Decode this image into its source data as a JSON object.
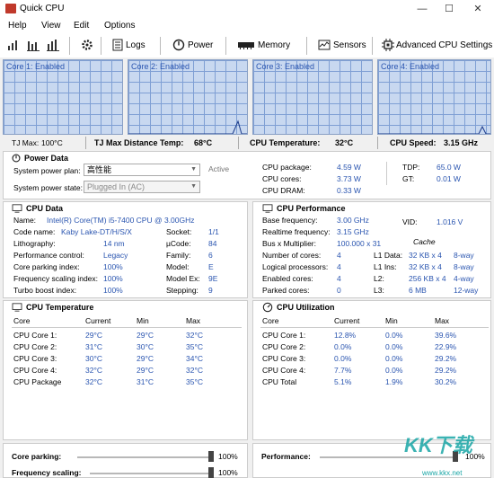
{
  "window": {
    "title": "Quick CPU",
    "minimize": "—",
    "maximize": "☐",
    "close": "✕"
  },
  "menu": {
    "help": "Help",
    "view": "View",
    "edit": "Edit",
    "options": "Options"
  },
  "toolbar": {
    "logs": "Logs",
    "power": "Power",
    "memory": "Memory",
    "sensors": "Sensors",
    "advanced": "Advanced CPU Settings"
  },
  "graphs": [
    {
      "label": "Core 1: Enabled"
    },
    {
      "label": "Core 2: Enabled"
    },
    {
      "label": "Core 3: Enabled"
    },
    {
      "label": "Core 4: Enabled"
    }
  ],
  "status": {
    "tj_max_label": "TJ Max:",
    "tj_max_value": "100°C",
    "tj_dist_label": "TJ Max Distance Temp:",
    "tj_dist_value": "68°C",
    "cpu_temp_label": "CPU Temperature:",
    "cpu_temp_value": "32°C",
    "cpu_speed_label": "CPU Speed:",
    "cpu_speed_value": "3.15 GHz"
  },
  "power_data": {
    "title": "Power Data",
    "plan_label": "System power plan:",
    "plan_value": "高性能",
    "active": "Active",
    "state_label": "System power state:",
    "state_value": "Plugged In (AC)",
    "package_label": "CPU package:",
    "package_value": "4.59 W",
    "cores_label": "CPU cores:",
    "cores_value": "3.73 W",
    "dram_label": "CPU DRAM:",
    "dram_value": "0.33 W",
    "tdp_label": "TDP:",
    "tdp_value": "65.0 W",
    "gt_label": "GT:",
    "gt_value": "0.01 W"
  },
  "cpu_data": {
    "title": "CPU Data",
    "rows": [
      {
        "label": "Name:",
        "value": "Intel(R) Core(TM) i5-7400 CPU @ 3.00GHz"
      },
      {
        "label": "Code name:",
        "value": "Kaby Lake-DT/H/S/X"
      },
      {
        "label": "Lithography:",
        "value": "14 nm"
      },
      {
        "label": "Performance control:",
        "value": "Legacy"
      },
      {
        "label": "Core parking index:",
        "value": "100%"
      },
      {
        "label": "Frequency scaling index:",
        "value": "100%"
      },
      {
        "label": "Turbo boost index:",
        "value": "100%"
      }
    ],
    "right": [
      {
        "label": "Socket:",
        "value": "1/1"
      },
      {
        "label": "µCode:",
        "value": "84"
      },
      {
        "label": "Family:",
        "value": "6"
      },
      {
        "label": "Model:",
        "value": "E"
      },
      {
        "label": "Model Ex:",
        "value": "9E"
      },
      {
        "label": "Stepping:",
        "value": "9"
      }
    ]
  },
  "cpu_perf": {
    "title": "CPU Performance",
    "base_label": "Base frequency:",
    "base_value": "3.00 GHz",
    "rt_label": "Realtime frequency:",
    "rt_value": "3.15 GHz",
    "bus_label": "Bus x Multiplier:",
    "bus_value": "100.000 x 31",
    "vid_label": "VID:",
    "vid_value": "1.016 V",
    "cache_title": "Cache",
    "rows": [
      {
        "label": "Number of cores:",
        "value": "4",
        "cl": "L1 Data:",
        "cv": "32 KB x 4",
        "cw": "8-way"
      },
      {
        "label": "Logical processors:",
        "value": "4",
        "cl": "L1 Ins:",
        "cv": "32 KB x 4",
        "cw": "8-way"
      },
      {
        "label": "Enabled cores:",
        "value": "4",
        "cl": "L2:",
        "cv": "256 KB x 4",
        "cw": "4-way"
      },
      {
        "label": "Parked cores:",
        "value": "0",
        "cl": "L3:",
        "cv": "6 MB",
        "cw": "12-way"
      }
    ]
  },
  "cpu_temp": {
    "title": "CPU Temperature",
    "headers": [
      "Core",
      "Current",
      "Min",
      "Max"
    ],
    "rows": [
      [
        "CPU Core 1:",
        "29°C",
        "29°C",
        "32°C"
      ],
      [
        "CPU Core 2:",
        "31°C",
        "30°C",
        "35°C"
      ],
      [
        "CPU Core 3:",
        "30°C",
        "29°C",
        "34°C"
      ],
      [
        "CPU Core 4:",
        "32°C",
        "29°C",
        "32°C"
      ],
      [
        "CPU Package",
        "32°C",
        "31°C",
        "35°C"
      ]
    ]
  },
  "cpu_util": {
    "title": "CPU Utilization",
    "headers": [
      "Core",
      "Current",
      "Min",
      "Max"
    ],
    "rows": [
      [
        "CPU Core 1:",
        "12.8%",
        "0.0%",
        "39.6%"
      ],
      [
        "CPU Core 2:",
        "0.0%",
        "0.0%",
        "22.9%"
      ],
      [
        "CPU Core 3:",
        "0.0%",
        "0.0%",
        "29.2%"
      ],
      [
        "CPU Core 4:",
        "7.7%",
        "0.0%",
        "29.2%"
      ],
      [
        "CPU Total",
        "5.1%",
        "1.9%",
        "30.2%"
      ]
    ]
  },
  "sliders": {
    "parking_label": "Core parking:",
    "parking_value": "100%",
    "freq_label": "Frequency scaling:",
    "freq_value": "100%",
    "perf_label": "Performance:",
    "perf_value": "100%"
  },
  "watermark": {
    "logo": "KK下载",
    "url": "www.kkx.net"
  }
}
